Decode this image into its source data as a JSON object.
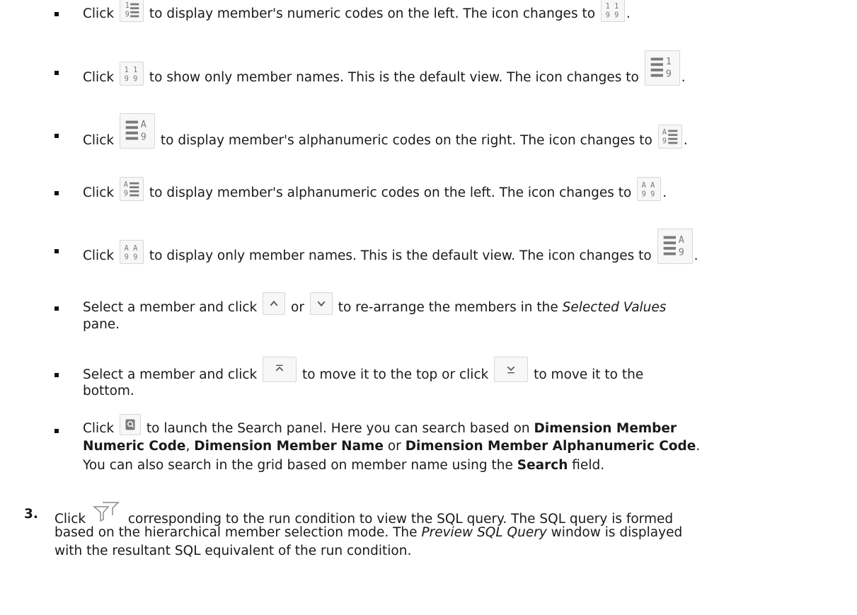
{
  "bullets": [
    {
      "pre": "Click",
      "post": "to display member's numeric codes on the left. The icon changes to",
      "end": "."
    },
    {
      "pre": "Click",
      "post": "to show only member names. This is the default view. The icon changes to",
      "end": "."
    },
    {
      "pre": "Click",
      "post": "to display member's alphanumeric codes on the right. The icon changes to",
      "end": "."
    },
    {
      "pre": "Click",
      "post": "to display member's alphanumeric codes on the left. The icon changes to",
      "end": "."
    },
    {
      "pre": "Click",
      "post": "to display only member names. This is the default view. The icon changes to",
      "end": "."
    }
  ],
  "arrange": {
    "pre": "Select a member and click",
    "or": "or",
    "post": "to re-arrange the members in the",
    "pane_name": "Selected Values",
    "line2": "pane."
  },
  "topbottom": {
    "pre": "Select a member and click",
    "mid": "to move it to the top or click",
    "post": "to move it to the",
    "line2": "bottom."
  },
  "search": {
    "pre": "Click",
    "post": "to launch the Search panel. Here you can search based on",
    "b1": "Dimension Member",
    "b1b": "Numeric Code",
    "sep1": ",",
    "b2": "Dimension Member Name",
    "or": "or",
    "b3": "Dimension Member Alphanumeric Code",
    "end": ".",
    "line3a": "You can also search in the grid based on member name using the",
    "b4": "Search",
    "line3b": "field."
  },
  "step3": {
    "number": "3.",
    "pre": "Click",
    "post": "corresponding to the run condition to view the SQL query. The SQL query is formed",
    "line2a": "based on the hierarchical member selection mode. The",
    "window_name": "Preview SQL Query",
    "line2b": "window is displayed",
    "line3": "with the resultant SQL equivalent of the run condition."
  },
  "icons": {
    "numeric_left": "1\n9",
    "numeric_both": "11\n99",
    "alpha_right": "A\n9",
    "alpha_both": "AA\n99"
  }
}
